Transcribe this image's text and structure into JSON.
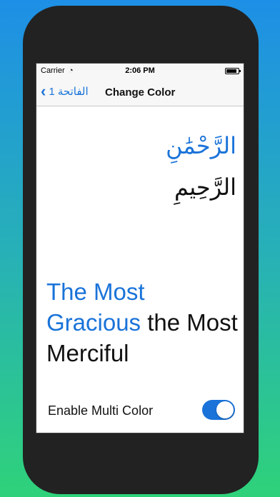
{
  "status": {
    "carrier": "Carrier",
    "time": "2:06 PM",
    "battery_level": 0.85
  },
  "nav": {
    "back_label": "1 الفاتحة",
    "title": "Change Color"
  },
  "arabic": {
    "line1": "الرَّحْمَٰنِ",
    "line2": "الرَّحِيمِ"
  },
  "meaning": {
    "part1": "The Most Gracious",
    "part2": " the Most Merciful"
  },
  "settings": {
    "multicolor_label": "Enable Multi Color",
    "multicolor_on": true
  },
  "colors": {
    "accent": "#1a73d9",
    "text": "#111111",
    "bg_top": "#1e8fe6",
    "bg_bottom": "#2fd27a"
  }
}
